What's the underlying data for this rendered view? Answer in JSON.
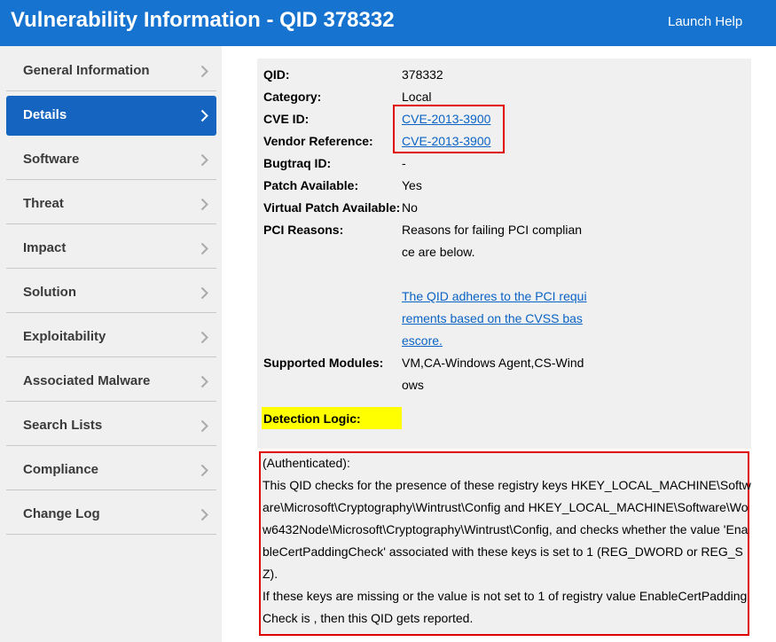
{
  "header": {
    "title": "Vulnerability Information - QID 378332",
    "help_link": "Launch Help"
  },
  "sidebar": {
    "items": [
      {
        "label": "General Information",
        "active": false
      },
      {
        "label": "Details",
        "active": true
      },
      {
        "label": "Software",
        "active": false
      },
      {
        "label": "Threat",
        "active": false
      },
      {
        "label": "Impact",
        "active": false
      },
      {
        "label": "Solution",
        "active": false
      },
      {
        "label": "Exploitability",
        "active": false
      },
      {
        "label": "Associated Malware",
        "active": false
      },
      {
        "label": "Search Lists",
        "active": false
      },
      {
        "label": "Compliance",
        "active": false
      },
      {
        "label": "Change Log",
        "active": false
      }
    ]
  },
  "details": {
    "qid_label": "QID:",
    "qid_value": "378332",
    "category_label": "Category:",
    "category_value": "Local",
    "cve_label": "CVE ID:",
    "cve_value": "CVE-2013-3900",
    "vendor_label": "Vendor Reference:",
    "vendor_value": "CVE-2013-3900",
    "bugtraq_label": "Bugtraq ID:",
    "bugtraq_value": "-",
    "patch_label": "Patch Available:",
    "patch_value": "Yes",
    "vpatch_label": "Virtual Patch Available:",
    "vpatch_value": "No",
    "pci_label": "PCI Reasons:",
    "pci_lines": [
      "Reasons for failing PCI complian",
      "ce are below."
    ],
    "pci_link_lines": [
      "The QID adheres to the PCI requi",
      "rements based on the CVSS bas",
      "escore."
    ],
    "modules_label": "Supported Modules:",
    "modules_lines": [
      "VM,CA-Windows Agent,CS-Wind",
      "ows"
    ]
  },
  "detection": {
    "label": "Detection Logic:",
    "lines": [
      "(Authenticated):",
      "This QID checks for the presence of these registry keys HKEY_LOCAL_MACHINE\\Softw",
      "are\\Microsoft\\Cryptography\\Wintrust\\Config and HKEY_LOCAL_MACHINE\\Software\\Wo",
      "w6432Node\\Microsoft\\Cryptography\\Wintrust\\Config, and checks whether the value 'Ena",
      "bleCertPaddingCheck' associated with these keys is set to 1 (REG_DWORD or REG_S",
      "Z).",
      "If these keys are missing or the value is not set to 1 of registry value EnableCertPadding",
      "Check is , then this QID gets reported."
    ]
  },
  "colors": {
    "header_bg": "#1673d0",
    "active_nav": "#1565c0",
    "link": "#0a63c4",
    "highlight_red": "#e00000",
    "highlight_yellow": "#ffff00"
  }
}
